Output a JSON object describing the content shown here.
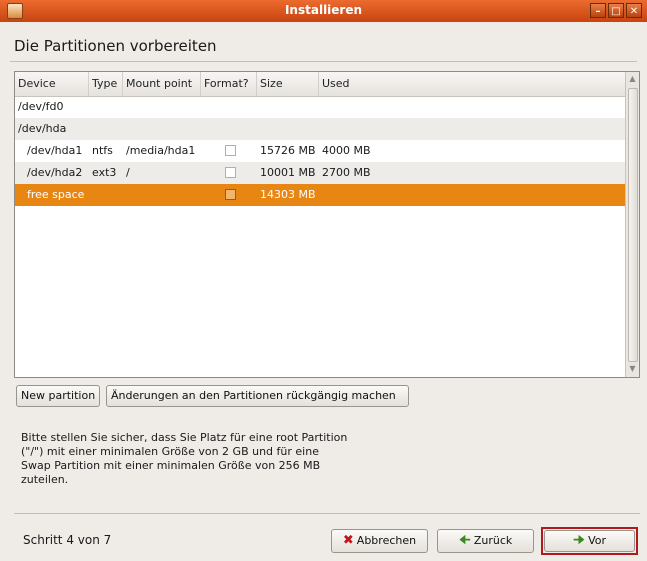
{
  "window": {
    "title": "Installieren",
    "controls": [
      "minimize",
      "maximize",
      "close"
    ]
  },
  "page": {
    "heading": "Die Partitionen vorbereiten"
  },
  "table": {
    "columns": [
      "Device",
      "Type",
      "Mount point",
      "Format?",
      "Size",
      "Used"
    ],
    "rows": [
      {
        "device": "/dev/fd0",
        "type": "",
        "mount": "",
        "format": null,
        "size": "",
        "used": ""
      },
      {
        "device": "/dev/hda",
        "type": "",
        "mount": "",
        "format": null,
        "size": "",
        "used": ""
      },
      {
        "device": "/dev/hda1",
        "type": "ntfs",
        "mount": "/media/hda1",
        "format": false,
        "size": "15726 MB",
        "used": "4000 MB"
      },
      {
        "device": "/dev/hda2",
        "type": "ext3",
        "mount": "/",
        "format": false,
        "size": "10001 MB",
        "used": "2700 MB"
      },
      {
        "device": "free space",
        "type": "",
        "mount": "",
        "format": false,
        "size": "14303 MB",
        "used": "",
        "selected": true
      }
    ]
  },
  "actions": {
    "new_partition": "New partition",
    "undo_changes": "Änderungen an den Partitionen rückgängig machen"
  },
  "info_text": "Bitte stellen Sie sicher, dass Sie Platz für eine root Partition (\"/\") mit einer minimalen Größe von 2 GB und für eine Swap Partition mit einer minimalen Größe von 256 MB zuteilen.",
  "footer": {
    "step": "Schritt 4 von 7",
    "cancel": "Abbrechen",
    "back": "Zurück",
    "forward": "Vor"
  },
  "colors": {
    "title_bar": "#d9541c",
    "selection": "#e88614",
    "focus_border": "#b01a1a"
  }
}
